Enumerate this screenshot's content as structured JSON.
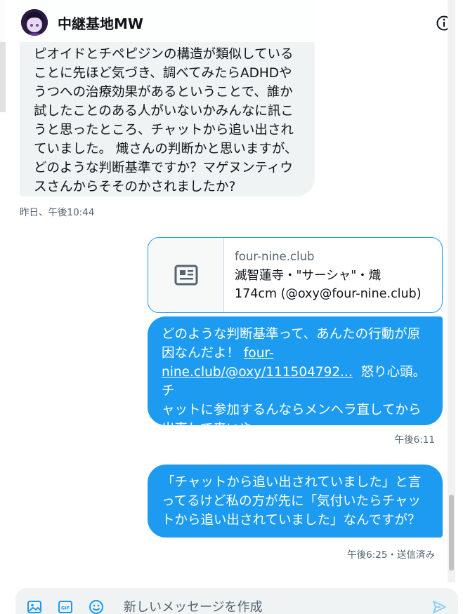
{
  "header": {
    "title": "中継基地MW"
  },
  "messages": {
    "received": {
      "text": "ピオイドとチペピジンの構造が類似している\nことに先ほど気づき、調べてみたらADHDや\nうつへの治療効果があるということで、誰か\n試したことのある人がいないかみんなに訊こ\nうと思ったところ、チャットから追い出され\nていました。 熾さんの判断かと思いますが、\nどのような判断基準ですか？マゲヌンティウ\nスさんからそそのかされましたか?",
      "time": "昨日、午後10:44"
    },
    "link_card": {
      "domain": "four-nine.club",
      "title": "滅智蓮寺・\"サーシャ\"・熾\n174cm (@oxy@four-nine.club)"
    },
    "sent_1": {
      "text_a": "どのような判断基準って、あんたの行動が原\n因なんだよ！ ",
      "link": "four-\nnine.club/@oxy/111504792...",
      "text_b": "  怒り心頭。チ\nャットに参加するんならメンヘラ直してから\n出直して来いや。",
      "time": "午後6:11"
    },
    "sent_2": {
      "text": "「チャットから追い出されていました」と言\nってるけど私の方が先に「気付いたらチャッ\nトから追い出されていました」なんですが？",
      "time": "午後6:25・送信済み"
    }
  },
  "composer": {
    "placeholder": "新しいメッセージを作成"
  },
  "icons": {
    "info": "info-icon",
    "card": "article-icon",
    "image": "image-icon",
    "gif": "gif-icon",
    "emoji": "emoji-icon",
    "send": "send-icon"
  },
  "colors": {
    "accent": "#1d9bf0",
    "bubble_received": "#eff3f4",
    "muted": "#536471"
  }
}
